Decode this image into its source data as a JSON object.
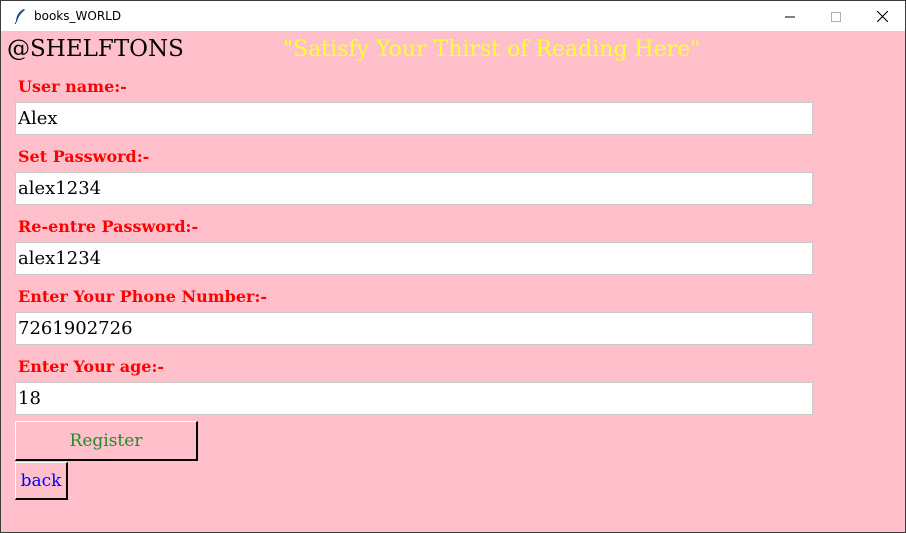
{
  "window": {
    "title": "books_WORLD",
    "icon": "feather-icon",
    "controls": [
      "minimize-icon",
      "maximize-icon",
      "close-icon"
    ]
  },
  "header": {
    "brand": "@SHELFTONS",
    "tagline": "\"Satisfy Your Thirst of Reading Here\""
  },
  "form": {
    "fields": [
      {
        "label": "User name:-",
        "value": "Alex"
      },
      {
        "label": "Set Password:-",
        "value": "alex1234"
      },
      {
        "label": "Re-entre Password:-",
        "value": "alex1234"
      },
      {
        "label": "Enter Your Phone Number:-",
        "value": "7261902726"
      },
      {
        "label": "Enter Your age:-",
        "value": "18"
      }
    ],
    "register_label": "Register",
    "back_label": "back"
  },
  "colors": {
    "background": "#ffc0cb",
    "label_color": "#ff0000",
    "tagline_color": "#ffff33",
    "register_text": "#228b22",
    "back_text": "#0000ff"
  }
}
